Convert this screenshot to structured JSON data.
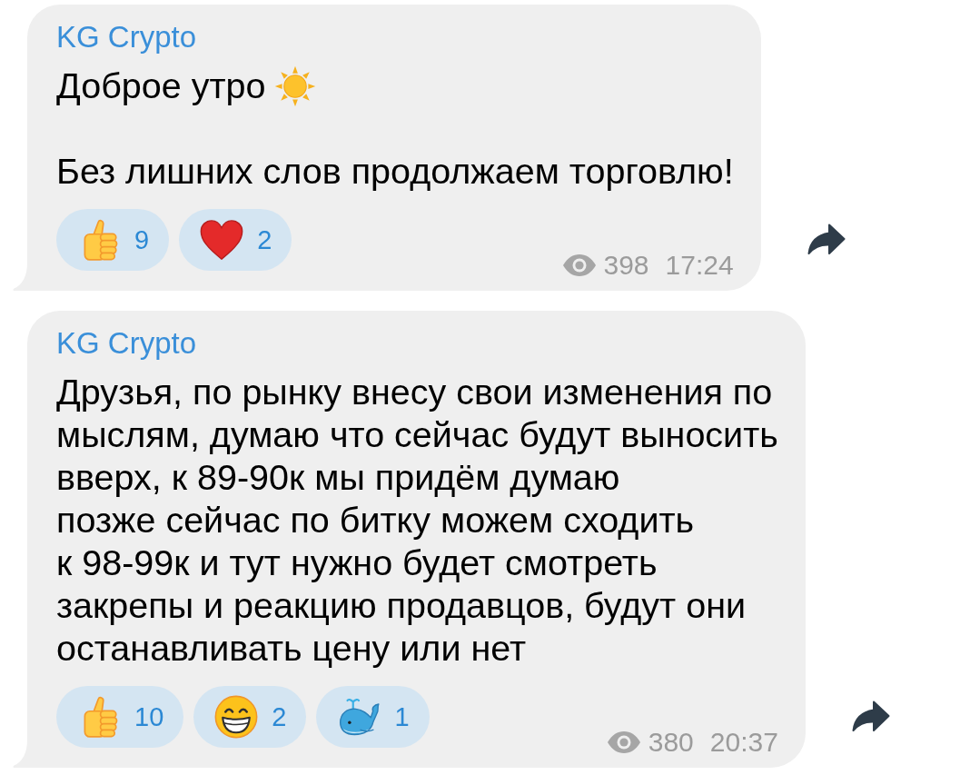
{
  "messages": [
    {
      "author": "KG Crypto",
      "paragraphs": [
        {
          "kind": "sun",
          "text": "Доброе утро"
        },
        {
          "kind": "plain",
          "text": "Без лишних слов продолжаем торговлю!"
        }
      ],
      "reactions": [
        {
          "kind": "thumbs_up",
          "count": "9"
        },
        {
          "kind": "heart",
          "count": "2"
        }
      ],
      "views": "398",
      "time": "17:24"
    },
    {
      "author": "KG Crypto",
      "paragraphs": [
        {
          "kind": "plain",
          "text": "Друзья, по рынку внесу свои изменения по\nмыслям, думаю что сейчас будут выносить\nвверх, к 89-90к мы придём думаю\nпозже сейчас по битку можем сходить\nк 98-99к и тут нужно будет смотреть\nзакрепы и реакцию продавцов, будут они\nостанавливать цену или нет"
        }
      ],
      "reactions": [
        {
          "kind": "thumbs_up",
          "count": "10"
        },
        {
          "kind": "grin",
          "count": "2"
        },
        {
          "kind": "whale",
          "count": "1"
        }
      ],
      "views": "380",
      "time": "20:37"
    }
  ]
}
